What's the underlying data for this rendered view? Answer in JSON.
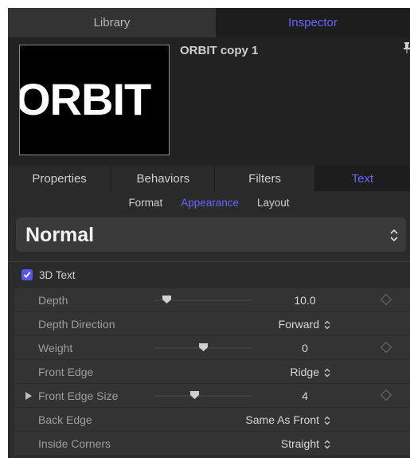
{
  "top_tabs": {
    "library": "Library",
    "inspector": "Inspector"
  },
  "preview": {
    "logo_text": "ORBIT",
    "title": "ORBIT copy 1"
  },
  "sub_tabs": [
    "Properties",
    "Behaviors",
    "Filters",
    "Text"
  ],
  "text_panes": {
    "format": "Format",
    "appearance": "Appearance",
    "layout": "Layout"
  },
  "preset": {
    "value": "Normal"
  },
  "section": {
    "label": "3D Text",
    "checked": true
  },
  "params": {
    "depth": {
      "label": "Depth",
      "value": "10.0",
      "slider": 0.13
    },
    "depth_direction": {
      "label": "Depth Direction",
      "value": "Forward"
    },
    "weight": {
      "label": "Weight",
      "value": "0",
      "slider": 0.5
    },
    "front_edge": {
      "label": "Front Edge",
      "value": "Ridge"
    },
    "front_edge_size": {
      "label": "Front Edge Size",
      "value": "4",
      "slider": 0.41
    },
    "back_edge": {
      "label": "Back Edge",
      "value": "Same As Front"
    },
    "inside_corners": {
      "label": "Inside Corners",
      "value": "Straight"
    }
  },
  "colors": {
    "accent": "#6a63ff",
    "checkbox": "#5b55e8"
  }
}
